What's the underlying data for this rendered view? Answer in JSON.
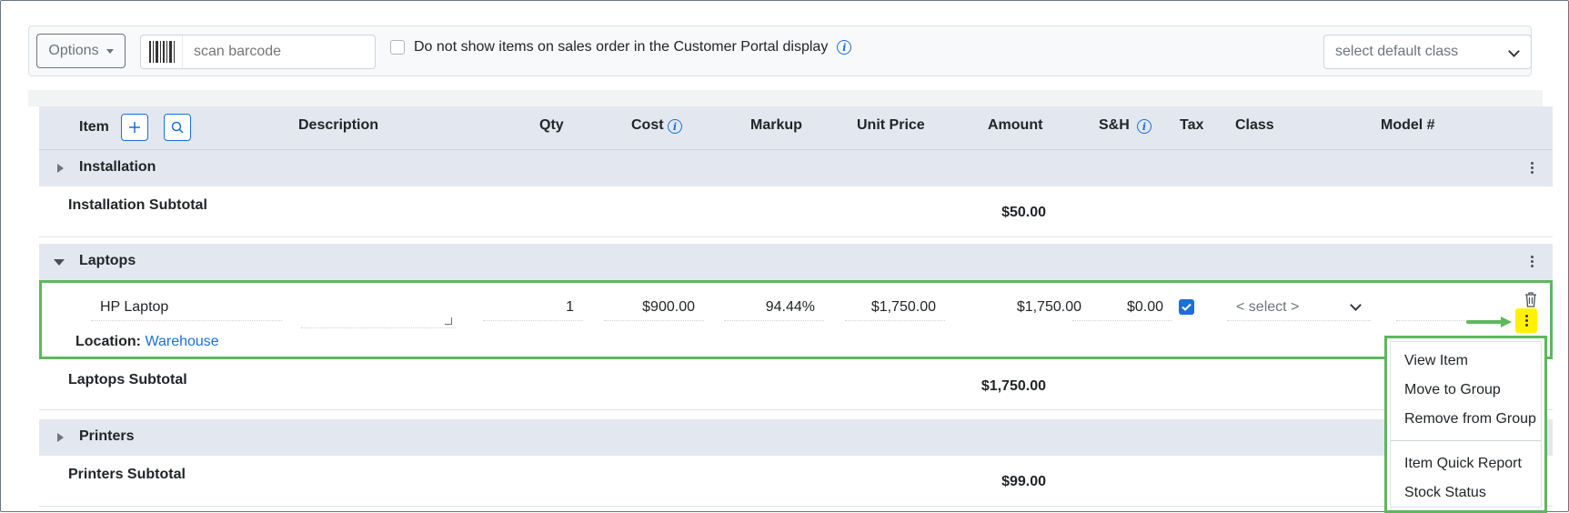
{
  "toolbar": {
    "options_label": "Options",
    "barcode_placeholder": "scan barcode",
    "portal_checkbox_label": "Do not show items on sales order in the Customer Portal display",
    "default_class_placeholder": "select default class"
  },
  "table": {
    "headers": {
      "item": "Item",
      "description": "Description",
      "qty": "Qty",
      "cost": "Cost",
      "markup": "Markup",
      "unit_price": "Unit Price",
      "amount": "Amount",
      "sh": "S&H",
      "tax": "Tax",
      "class": "Class",
      "model": "Model #"
    },
    "groups": [
      {
        "name": "Installation",
        "expanded": false,
        "subtotal_label": "Installation Subtotal",
        "subtotal": "$50.00"
      },
      {
        "name": "Laptops",
        "expanded": true,
        "subtotal_label": "Laptops Subtotal",
        "subtotal": "$1,750.00"
      },
      {
        "name": "Printers",
        "expanded": false,
        "subtotal_label": "Printers Subtotal",
        "subtotal": "$99.00"
      }
    ],
    "line_item": {
      "item": "HP Laptop",
      "description": "",
      "qty": "1",
      "cost": "$900.00",
      "markup": "94.44%",
      "unit_price": "$1,750.00",
      "amount": "$1,750.00",
      "sh": "$0.00",
      "tax_checked": true,
      "class_placeholder": "< select >",
      "location_label": "Location:",
      "location_value": "Warehouse"
    }
  },
  "context_menu": {
    "items": [
      "View Item",
      "Move to Group",
      "Remove from Group",
      "Item Quick Report",
      "Stock Status"
    ]
  },
  "colors": {
    "accent": "#1a6fd9",
    "highlight_border": "#5cb85c",
    "kebab_highlight": "#fff200",
    "row_band": "#e3e8f0"
  }
}
